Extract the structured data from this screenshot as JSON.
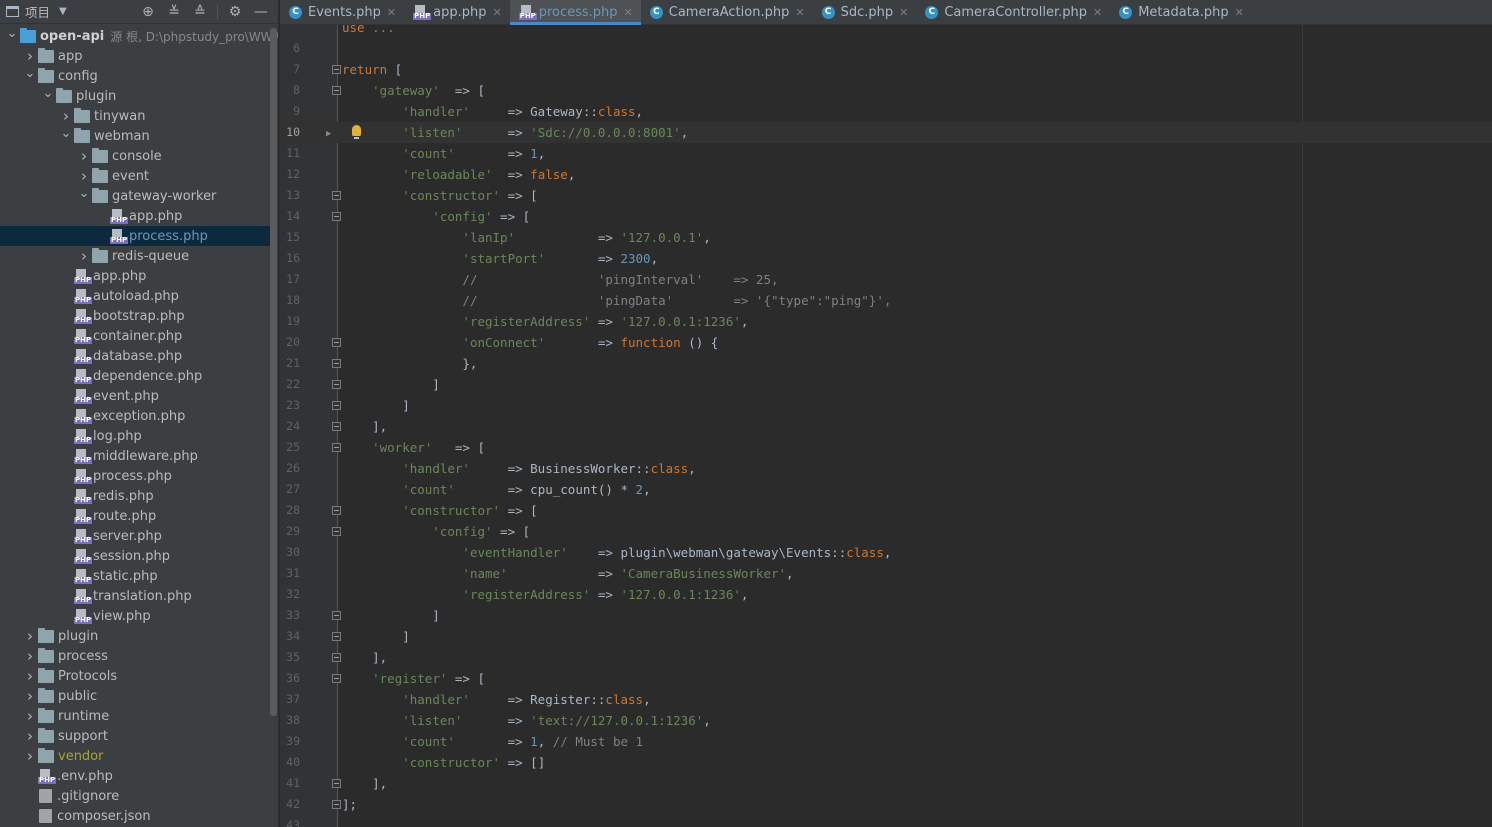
{
  "project_panel": {
    "title": "项目",
    "tree": [
      {
        "label": "open-api",
        "meta": "源 根, D:\\phpstudy_pro\\WWW",
        "depth": 0,
        "type": "root",
        "expanded": true
      },
      {
        "label": "app",
        "depth": 1,
        "type": "folder",
        "expanded": false
      },
      {
        "label": "config",
        "depth": 1,
        "type": "folder",
        "expanded": true
      },
      {
        "label": "plugin",
        "depth": 2,
        "type": "folder",
        "expanded": true
      },
      {
        "label": "tinywan",
        "depth": 3,
        "type": "folder",
        "expanded": false
      },
      {
        "label": "webman",
        "depth": 3,
        "type": "folder",
        "expanded": true
      },
      {
        "label": "console",
        "depth": 4,
        "type": "folder",
        "expanded": false
      },
      {
        "label": "event",
        "depth": 4,
        "type": "folder",
        "expanded": false
      },
      {
        "label": "gateway-worker",
        "depth": 4,
        "type": "folder",
        "expanded": true
      },
      {
        "label": "app.php",
        "depth": 5,
        "type": "php"
      },
      {
        "label": "process.php",
        "depth": 5,
        "type": "php",
        "selected": true
      },
      {
        "label": "redis-queue",
        "depth": 4,
        "type": "folder",
        "expanded": false
      },
      {
        "label": "app.php",
        "depth": 3,
        "type": "php"
      },
      {
        "label": "autoload.php",
        "depth": 3,
        "type": "php"
      },
      {
        "label": "bootstrap.php",
        "depth": 3,
        "type": "php"
      },
      {
        "label": "container.php",
        "depth": 3,
        "type": "php"
      },
      {
        "label": "database.php",
        "depth": 3,
        "type": "php"
      },
      {
        "label": "dependence.php",
        "depth": 3,
        "type": "php"
      },
      {
        "label": "event.php",
        "depth": 3,
        "type": "php"
      },
      {
        "label": "exception.php",
        "depth": 3,
        "type": "php"
      },
      {
        "label": "log.php",
        "depth": 3,
        "type": "php"
      },
      {
        "label": "middleware.php",
        "depth": 3,
        "type": "php"
      },
      {
        "label": "process.php",
        "depth": 3,
        "type": "php"
      },
      {
        "label": "redis.php",
        "depth": 3,
        "type": "php"
      },
      {
        "label": "route.php",
        "depth": 3,
        "type": "php"
      },
      {
        "label": "server.php",
        "depth": 3,
        "type": "php"
      },
      {
        "label": "session.php",
        "depth": 3,
        "type": "php"
      },
      {
        "label": "static.php",
        "depth": 3,
        "type": "php"
      },
      {
        "label": "translation.php",
        "depth": 3,
        "type": "php"
      },
      {
        "label": "view.php",
        "depth": 3,
        "type": "php"
      },
      {
        "label": "plugin",
        "depth": 1,
        "type": "folder",
        "expanded": false
      },
      {
        "label": "process",
        "depth": 1,
        "type": "folder",
        "expanded": false
      },
      {
        "label": "Protocols",
        "depth": 1,
        "type": "folder",
        "expanded": false
      },
      {
        "label": "public",
        "depth": 1,
        "type": "folder",
        "expanded": false
      },
      {
        "label": "runtime",
        "depth": 1,
        "type": "folder",
        "expanded": false
      },
      {
        "label": "support",
        "depth": 1,
        "type": "folder",
        "expanded": false
      },
      {
        "label": "vendor",
        "depth": 1,
        "type": "folder",
        "expanded": false,
        "excluded": true
      },
      {
        "label": ".env.php",
        "depth": 1,
        "type": "php"
      },
      {
        "label": ".gitignore",
        "depth": 1,
        "type": "git"
      },
      {
        "label": "composer.json",
        "depth": 1,
        "type": "json"
      }
    ]
  },
  "tabs": [
    {
      "label": "Events.php",
      "icon": "class-icon",
      "active": false
    },
    {
      "label": "app.php",
      "icon": "php-file-icon",
      "active": false
    },
    {
      "label": "process.php",
      "icon": "php-file-icon",
      "active": true
    },
    {
      "label": "CameraAction.php",
      "icon": "class-icon",
      "active": false
    },
    {
      "label": "Sdc.php",
      "icon": "class-icon",
      "active": false
    },
    {
      "label": "CameraController.php",
      "icon": "class-icon",
      "active": false
    },
    {
      "label": "Metadata.php",
      "icon": "class-icon",
      "active": false
    }
  ],
  "editor": {
    "current_line": 10,
    "lines": [
      {
        "n": "",
        "fold": "",
        "parts": [
          [
            "k",
            "use "
          ],
          [
            "c",
            "..."
          ]
        ]
      },
      {
        "n": "6",
        "fold": "",
        "parts": []
      },
      {
        "n": "7",
        "fold": "open",
        "parts": [
          [
            "k",
            "return"
          ],
          [
            "p",
            " ["
          ]
        ]
      },
      {
        "n": "8",
        "fold": "open",
        "parts": [
          [
            "p",
            "    "
          ],
          [
            "s",
            "'gateway'"
          ],
          [
            "p",
            "  => ["
          ]
        ]
      },
      {
        "n": "9",
        "fold": "",
        "parts": [
          [
            "p",
            "        "
          ],
          [
            "s",
            "'handler'"
          ],
          [
            "p",
            "     => Gateway::"
          ],
          [
            "k",
            "class"
          ],
          [
            "p",
            ","
          ]
        ]
      },
      {
        "n": "10",
        "fold": "",
        "parts": [
          [
            "p",
            "        "
          ],
          [
            "s",
            "'listen'"
          ],
          [
            "p",
            "      => "
          ],
          [
            "s",
            "'Sdc://0.0.0.0:8001'"
          ],
          [
            "p",
            ","
          ]
        ]
      },
      {
        "n": "11",
        "fold": "",
        "parts": [
          [
            "p",
            "        "
          ],
          [
            "s",
            "'count'"
          ],
          [
            "p",
            "       => "
          ],
          [
            "n",
            "1"
          ],
          [
            "p",
            ","
          ]
        ]
      },
      {
        "n": "12",
        "fold": "",
        "parts": [
          [
            "p",
            "        "
          ],
          [
            "s",
            "'reloadable'"
          ],
          [
            "p",
            "  => "
          ],
          [
            "k",
            "false"
          ],
          [
            "p",
            ","
          ]
        ]
      },
      {
        "n": "13",
        "fold": "open",
        "parts": [
          [
            "p",
            "        "
          ],
          [
            "s",
            "'constructor'"
          ],
          [
            "p",
            " => ["
          ]
        ]
      },
      {
        "n": "14",
        "fold": "open",
        "parts": [
          [
            "p",
            "            "
          ],
          [
            "s",
            "'config'"
          ],
          [
            "p",
            " => ["
          ]
        ]
      },
      {
        "n": "15",
        "fold": "",
        "parts": [
          [
            "p",
            "                "
          ],
          [
            "s",
            "'lanIp'"
          ],
          [
            "p",
            "           => "
          ],
          [
            "s",
            "'127.0.0.1'"
          ],
          [
            "p",
            ","
          ]
        ]
      },
      {
        "n": "16",
        "fold": "",
        "parts": [
          [
            "p",
            "                "
          ],
          [
            "s",
            "'startPort'"
          ],
          [
            "p",
            "       => "
          ],
          [
            "n",
            "2300"
          ],
          [
            "p",
            ","
          ]
        ]
      },
      {
        "n": "17",
        "fold": "",
        "parts": [
          [
            "p",
            "                "
          ],
          [
            "c",
            "//                'pingInterval'    => 25,"
          ]
        ]
      },
      {
        "n": "18",
        "fold": "",
        "parts": [
          [
            "p",
            "                "
          ],
          [
            "c",
            "//                'pingData'        => '{\"type\":\"ping\"}',"
          ]
        ]
      },
      {
        "n": "19",
        "fold": "",
        "parts": [
          [
            "p",
            "                "
          ],
          [
            "s",
            "'registerAddress'"
          ],
          [
            "p",
            " => "
          ],
          [
            "s",
            "'127.0.0.1:1236'"
          ],
          [
            "p",
            ","
          ]
        ]
      },
      {
        "n": "20",
        "fold": "open",
        "parts": [
          [
            "p",
            "                "
          ],
          [
            "s",
            "'onConnect'"
          ],
          [
            "p",
            "       => "
          ],
          [
            "k",
            "function"
          ],
          [
            "p",
            " () {"
          ]
        ]
      },
      {
        "n": "21",
        "fold": "open",
        "parts": [
          [
            "p",
            "                },"
          ]
        ]
      },
      {
        "n": "22",
        "fold": "open",
        "parts": [
          [
            "p",
            "            ]"
          ]
        ]
      },
      {
        "n": "23",
        "fold": "open",
        "parts": [
          [
            "p",
            "        ]"
          ]
        ]
      },
      {
        "n": "24",
        "fold": "open",
        "parts": [
          [
            "p",
            "    ],"
          ]
        ]
      },
      {
        "n": "25",
        "fold": "open",
        "parts": [
          [
            "p",
            "    "
          ],
          [
            "s",
            "'worker'"
          ],
          [
            "p",
            "   => ["
          ]
        ]
      },
      {
        "n": "26",
        "fold": "",
        "parts": [
          [
            "p",
            "        "
          ],
          [
            "s",
            "'handler'"
          ],
          [
            "p",
            "     => BusinessWorker::"
          ],
          [
            "k",
            "class"
          ],
          [
            "p",
            ","
          ]
        ]
      },
      {
        "n": "27",
        "fold": "",
        "parts": [
          [
            "p",
            "        "
          ],
          [
            "s",
            "'count'"
          ],
          [
            "p",
            "       => cpu_count() * "
          ],
          [
            "n",
            "2"
          ],
          [
            "p",
            ","
          ]
        ]
      },
      {
        "n": "28",
        "fold": "open",
        "parts": [
          [
            "p",
            "        "
          ],
          [
            "s",
            "'constructor'"
          ],
          [
            "p",
            " => ["
          ]
        ]
      },
      {
        "n": "29",
        "fold": "open",
        "parts": [
          [
            "p",
            "            "
          ],
          [
            "s",
            "'config'"
          ],
          [
            "p",
            " => ["
          ]
        ]
      },
      {
        "n": "30",
        "fold": "",
        "parts": [
          [
            "p",
            "                "
          ],
          [
            "s",
            "'eventHandler'"
          ],
          [
            "p",
            "    => plugin\\webman\\gateway\\Events::"
          ],
          [
            "k",
            "class"
          ],
          [
            "p",
            ","
          ]
        ]
      },
      {
        "n": "31",
        "fold": "",
        "parts": [
          [
            "p",
            "                "
          ],
          [
            "s",
            "'name'"
          ],
          [
            "p",
            "            => "
          ],
          [
            "s",
            "'CameraBusinessWorker'"
          ],
          [
            "p",
            ","
          ]
        ]
      },
      {
        "n": "32",
        "fold": "",
        "parts": [
          [
            "p",
            "                "
          ],
          [
            "s",
            "'registerAddress'"
          ],
          [
            "p",
            " => "
          ],
          [
            "s",
            "'127.0.0.1:1236'"
          ],
          [
            "p",
            ","
          ]
        ]
      },
      {
        "n": "33",
        "fold": "open",
        "parts": [
          [
            "p",
            "            ]"
          ]
        ]
      },
      {
        "n": "34",
        "fold": "open",
        "parts": [
          [
            "p",
            "        ]"
          ]
        ]
      },
      {
        "n": "35",
        "fold": "open",
        "parts": [
          [
            "p",
            "    ],"
          ]
        ]
      },
      {
        "n": "36",
        "fold": "open",
        "parts": [
          [
            "p",
            "    "
          ],
          [
            "s",
            "'register'"
          ],
          [
            "p",
            " => ["
          ]
        ]
      },
      {
        "n": "37",
        "fold": "",
        "parts": [
          [
            "p",
            "        "
          ],
          [
            "s",
            "'handler'"
          ],
          [
            "p",
            "     => Register::"
          ],
          [
            "k",
            "class"
          ],
          [
            "p",
            ","
          ]
        ]
      },
      {
        "n": "38",
        "fold": "",
        "parts": [
          [
            "p",
            "        "
          ],
          [
            "s",
            "'listen'"
          ],
          [
            "p",
            "      => "
          ],
          [
            "s",
            "'text://127.0.0.1:1236'"
          ],
          [
            "p",
            ","
          ]
        ]
      },
      {
        "n": "39",
        "fold": "",
        "parts": [
          [
            "p",
            "        "
          ],
          [
            "s",
            "'count'"
          ],
          [
            "p",
            "       => "
          ],
          [
            "n",
            "1"
          ],
          [
            "p",
            ", "
          ],
          [
            "c",
            "// Must be 1"
          ]
        ]
      },
      {
        "n": "40",
        "fold": "",
        "parts": [
          [
            "p",
            "        "
          ],
          [
            "s",
            "'constructor'"
          ],
          [
            "p",
            " => []"
          ]
        ]
      },
      {
        "n": "41",
        "fold": "open",
        "parts": [
          [
            "p",
            "    ],"
          ]
        ]
      },
      {
        "n": "42",
        "fold": "open",
        "parts": [
          [
            "p",
            "];"
          ]
        ]
      },
      {
        "n": "43",
        "fold": "",
        "parts": []
      }
    ]
  },
  "colors": {
    "panel_bg": "#3c3f41",
    "editor_bg": "#2b2b2b",
    "keyword": "#cc7832",
    "string": "#6a8759",
    "number": "#6897bb",
    "comment": "#808080",
    "selection": "#0d293e"
  }
}
